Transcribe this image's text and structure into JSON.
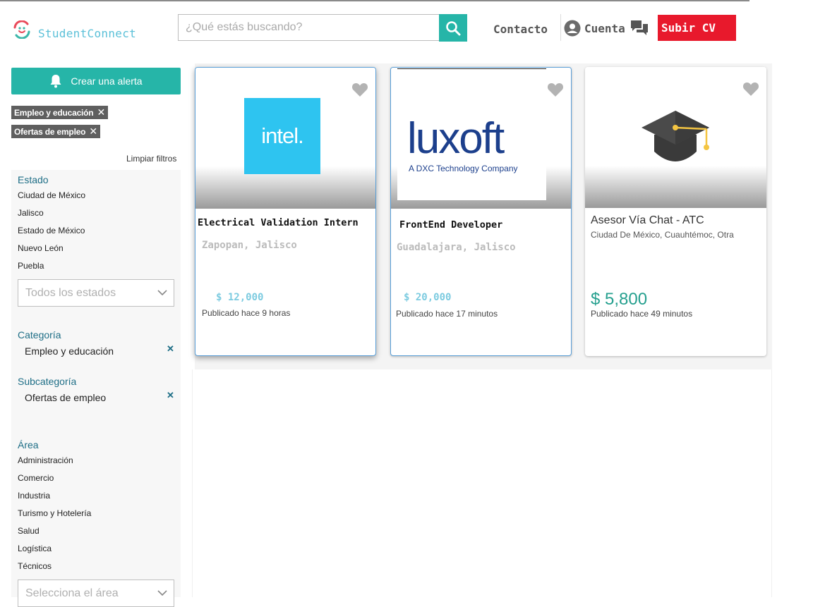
{
  "header": {
    "brand": "StudentConnect",
    "search_placeholder": "¿Qué estás buscando?",
    "contact_label": "Contacto",
    "account_label": "Cuenta",
    "upload_cv_label": "Subir CV",
    "accent_color": "#26b5a8",
    "cta_color": "#e8192c"
  },
  "sidebar": {
    "create_alert_label": "Crear una alerta",
    "active_chips": [
      "Empleo y educación",
      "Ofertas de empleo"
    ],
    "clear_filters_label": "Limpiar filtros",
    "state": {
      "title": "Estado",
      "items": [
        "Ciudad de México",
        "Jalisco",
        "Estado de México",
        "Nuevo León",
        "Puebla"
      ],
      "select_placeholder": "Todos los estados"
    },
    "category": {
      "title": "Categoría",
      "selected": "Empleo y educación"
    },
    "subcategory": {
      "title": "Subcategoría",
      "selected": "Ofertas de empleo"
    },
    "area": {
      "title": "Área",
      "items": [
        "Administración",
        "Comercio",
        "Industria",
        "Turismo y Hotelería",
        "Salud",
        "Logística",
        "Técnicos"
      ],
      "select_placeholder": "Selecciona el área"
    }
  },
  "listings": [
    {
      "logo_text": "intel.",
      "title": "Electrical Validation Intern",
      "location": "Zapopan, Jalisco",
      "price": "$ 12,000",
      "posted": "Publicado hace 9 horas"
    },
    {
      "logo_text": "luxoft",
      "logo_subtext": "A DXC Technology Company",
      "title": "FrontEnd Developer",
      "location": "Guadalajara, Jalisco",
      "price": "$ 20,000",
      "posted": "Publicado hace 17 minutos"
    },
    {
      "logo_icon": "graduation-cap-icon",
      "title": "Asesor Vía Chat - ATC",
      "location": "Ciudad De México, Cuauhtémoc, Otra",
      "price": "$ 5,800",
      "posted": "Publicado hace 49 minutos"
    }
  ]
}
